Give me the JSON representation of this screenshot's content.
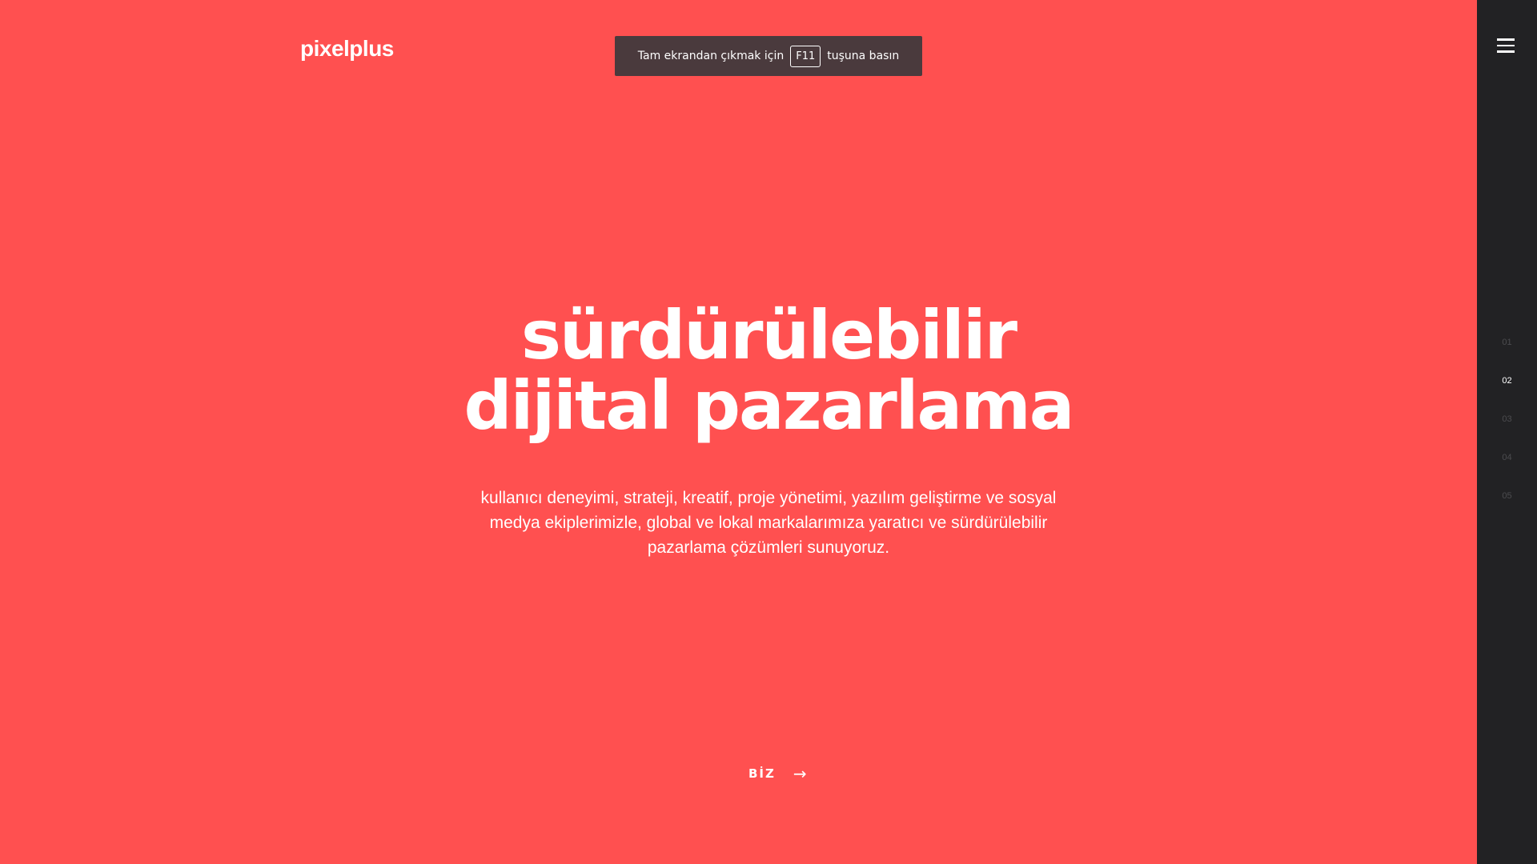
{
  "brand": {
    "logo_text": "pixelplus"
  },
  "fullscreen_notice": {
    "text_before": "Tam ekrandan çıkmak için",
    "key": "F11",
    "text_after": "tuşuna basın"
  },
  "hero": {
    "title_line1": "sürdürülebilir",
    "title_line2": "dijital pazarlama",
    "subtitle": "kullanıcı deneyimi, strateji, kreatif, proje yönetimi, yazılım geliştirme ve sosyal medya ekiplerimizle, global ve lokal markalarımıza yaratıcı ve sürdürülebilir pazarlama çözümleri sunuyoruz."
  },
  "cta": {
    "label": "BİZ",
    "icon": "arrow-right-icon"
  },
  "sidebar": {
    "menu_icon": "hamburger-menu-icon",
    "pager": [
      {
        "label": "01",
        "active": false
      },
      {
        "label": "02",
        "active": true
      },
      {
        "label": "03",
        "active": false
      },
      {
        "label": "04",
        "active": false
      },
      {
        "label": "05",
        "active": false
      }
    ]
  },
  "colors": {
    "background": "#ff5050",
    "sidebar": "#222224",
    "notice": "#4a3a3d",
    "text": "#ffffff"
  }
}
